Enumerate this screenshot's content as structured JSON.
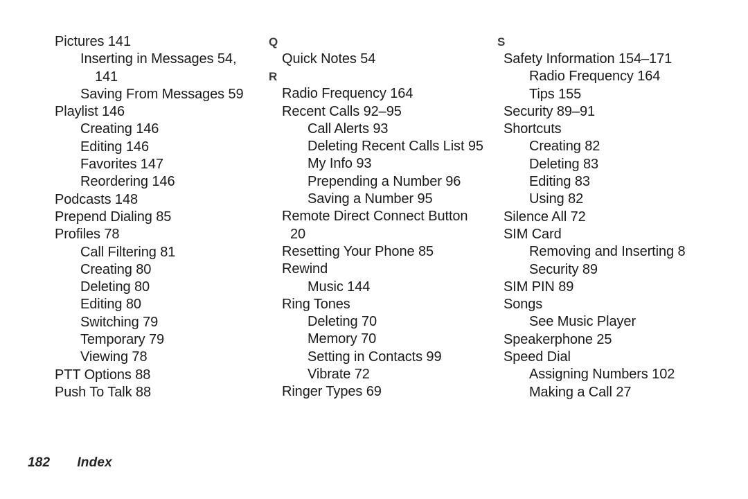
{
  "document": {
    "type": "index-page",
    "footer": {
      "page_number": "182",
      "label": "Index"
    }
  },
  "columns": [
    {
      "id": "column-1",
      "sections": [
        {
          "letter": null,
          "entries": [
            {
              "level": 1,
              "text": "Pictures 141",
              "wrap": null
            },
            {
              "level": 2,
              "text": "Inserting in Messages 54,",
              "wrap": "141"
            },
            {
              "level": 2,
              "text": "Saving From Messages 59",
              "wrap": null
            },
            {
              "level": 1,
              "text": "Playlist 146",
              "wrap": null
            },
            {
              "level": 2,
              "text": "Creating 146",
              "wrap": null
            },
            {
              "level": 2,
              "text": "Editing 146",
              "wrap": null
            },
            {
              "level": 2,
              "text": "Favorites 147",
              "wrap": null
            },
            {
              "level": 2,
              "text": "Reordering 146",
              "wrap": null
            },
            {
              "level": 1,
              "text": "Podcasts 148",
              "wrap": null
            },
            {
              "level": 1,
              "text": "Prepend Dialing 85",
              "wrap": null
            },
            {
              "level": 1,
              "text": "Profiles 78",
              "wrap": null
            },
            {
              "level": 2,
              "text": "Call Filtering 81",
              "wrap": null
            },
            {
              "level": 2,
              "text": "Creating 80",
              "wrap": null
            },
            {
              "level": 2,
              "text": "Deleting 80",
              "wrap": null
            },
            {
              "level": 2,
              "text": "Editing 80",
              "wrap": null
            },
            {
              "level": 2,
              "text": "Switching 79",
              "wrap": null
            },
            {
              "level": 2,
              "text": "Temporary 79",
              "wrap": null
            },
            {
              "level": 2,
              "text": "Viewing 78",
              "wrap": null
            },
            {
              "level": 1,
              "text": "PTT Options 88",
              "wrap": null
            },
            {
              "level": 1,
              "text": "Push To Talk 88",
              "wrap": null
            }
          ]
        }
      ]
    },
    {
      "id": "column-2",
      "sections": [
        {
          "letter": "Q",
          "entries": [
            {
              "level": 1,
              "text": "Quick Notes 54",
              "wrap": null
            }
          ]
        },
        {
          "letter": "R",
          "entries": [
            {
              "level": 1,
              "text": "Radio Frequency 164",
              "wrap": null
            },
            {
              "level": 1,
              "text": "Recent Calls 92–95",
              "wrap": null
            },
            {
              "level": 2,
              "text": "Call Alerts 93",
              "wrap": null
            },
            {
              "level": 2,
              "text": "Deleting Recent Calls List 95",
              "wrap": null
            },
            {
              "level": 2,
              "text": "My Info 93",
              "wrap": null
            },
            {
              "level": 2,
              "text": "Prepending a Number 96",
              "wrap": null
            },
            {
              "level": 2,
              "text": "Saving a Number 95",
              "wrap": null
            },
            {
              "level": 1,
              "text": "Remote Direct Connect Button",
              "wrap": "20"
            },
            {
              "level": 1,
              "text": "Resetting Your Phone 85",
              "wrap": null
            },
            {
              "level": 1,
              "text": "Rewind",
              "wrap": null
            },
            {
              "level": 2,
              "text": "Music 144",
              "wrap": null
            },
            {
              "level": 1,
              "text": "Ring Tones",
              "wrap": null
            },
            {
              "level": 2,
              "text": "Deleting 70",
              "wrap": null
            },
            {
              "level": 2,
              "text": "Memory 70",
              "wrap": null
            },
            {
              "level": 2,
              "text": "Setting in Contacts 99",
              "wrap": null
            },
            {
              "level": 2,
              "text": "Vibrate 72",
              "wrap": null
            },
            {
              "level": 1,
              "text": "Ringer Types 69",
              "wrap": null
            }
          ]
        }
      ]
    },
    {
      "id": "column-3",
      "sections": [
        {
          "letter": "S",
          "entries": [
            {
              "level": 1,
              "text": "Safety Information 154–171",
              "wrap": null
            },
            {
              "level": 2,
              "text": "Radio Frequency 164",
              "wrap": null
            },
            {
              "level": 2,
              "text": "Tips 155",
              "wrap": null
            },
            {
              "level": 1,
              "text": "Security 89–91",
              "wrap": null
            },
            {
              "level": 1,
              "text": "Shortcuts",
              "wrap": null
            },
            {
              "level": 2,
              "text": "Creating 82",
              "wrap": null
            },
            {
              "level": 2,
              "text": "Deleting 83",
              "wrap": null
            },
            {
              "level": 2,
              "text": "Editing 83",
              "wrap": null
            },
            {
              "level": 2,
              "text": "Using 82",
              "wrap": null
            },
            {
              "level": 1,
              "text": "Silence All 72",
              "wrap": null
            },
            {
              "level": 1,
              "text": "SIM Card",
              "wrap": null
            },
            {
              "level": 2,
              "text": "Removing and Inserting 8",
              "wrap": null
            },
            {
              "level": 2,
              "text": "Security 89",
              "wrap": null
            },
            {
              "level": 1,
              "text": "SIM PIN 89",
              "wrap": null
            },
            {
              "level": 1,
              "text": "Songs",
              "wrap": null
            },
            {
              "level": 2,
              "text": "See Music Player",
              "wrap": null
            },
            {
              "level": 1,
              "text": "Speakerphone 25",
              "wrap": null
            },
            {
              "level": 1,
              "text": "Speed Dial",
              "wrap": null
            },
            {
              "level": 2,
              "text": "Assigning Numbers 102",
              "wrap": null
            },
            {
              "level": 2,
              "text": "Making a Call 27",
              "wrap": null
            }
          ]
        }
      ]
    }
  ]
}
